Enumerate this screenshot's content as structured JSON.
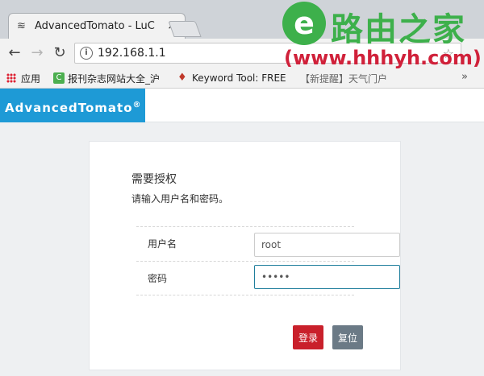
{
  "browser": {
    "tab_title": "AdvancedTomato - LuC",
    "tab_close": "×",
    "url": "192.168.1.1",
    "bookmarks": [
      {
        "label": "应用"
      },
      {
        "label": "报刊杂志网站大全_沪"
      },
      {
        "label": "Keyword Tool: FREE"
      },
      {
        "label": "【新提醒】天气门户"
      }
    ],
    "more": "»"
  },
  "watermark": {
    "title": "路由之家",
    "url": "(www.hhhyh.com)"
  },
  "router": {
    "brand": "AdvancedTomato",
    "brand_mark": "®",
    "login": {
      "title": "需要授权",
      "subtitle": "请输入用户名和密码。",
      "username_label": "用户名",
      "username_value": "root",
      "password_label": "密码",
      "password_value": "•••••",
      "login_button": "登录",
      "reset_button": "复位"
    }
  },
  "colors": {
    "brand": "#1e9ad6",
    "login_button": "#c9202b",
    "reset_button": "#6b7a86",
    "watermark_green": "#3db04b",
    "watermark_red": "#d0213a"
  }
}
